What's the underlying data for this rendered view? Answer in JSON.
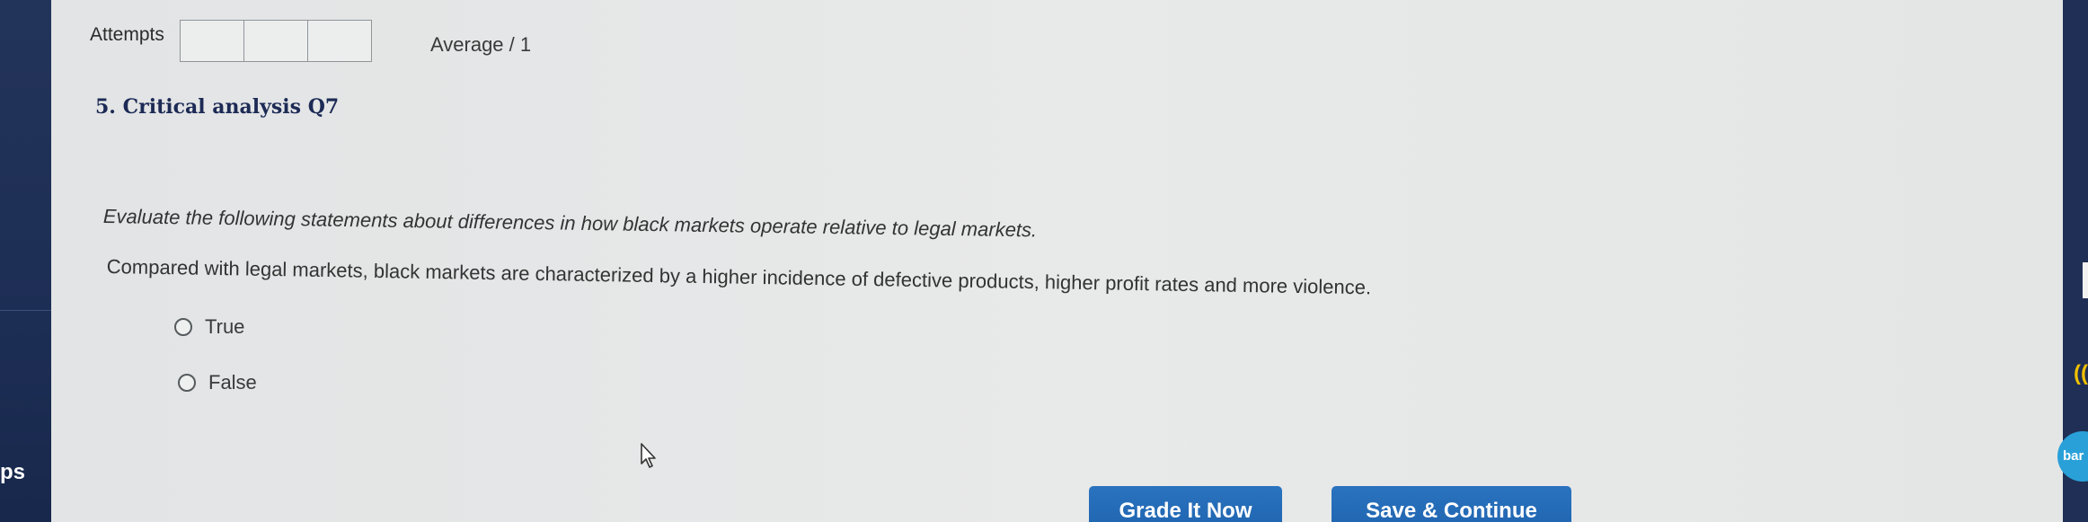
{
  "left_rail": {
    "label": "ps"
  },
  "right_rail": {
    "wifi_symbol": "((",
    "badge_text": "bar"
  },
  "attempts": {
    "label": "Attempts",
    "boxes": 3
  },
  "average": {
    "label": "Average / 1"
  },
  "question": {
    "title": "5. Critical analysis Q7",
    "prompt": "Evaluate the following statements about differences in how black markets operate relative to legal markets.",
    "statement": "Compared with legal markets, black markets are characterized by a higher incidence of defective products, higher profit rates and more violence.",
    "options": [
      {
        "label": "True",
        "selected": false
      },
      {
        "label": "False",
        "selected": false
      }
    ]
  },
  "buttons": {
    "grade": "Grade It Now",
    "save": "Save & Continue"
  },
  "colors": {
    "sidebar": "#1d2e55",
    "title": "#1c2a55",
    "button": "#2268b4",
    "badge": "#2aa0d8",
    "wifi": "#f0c000"
  },
  "icons": {
    "cursor": "mouse-pointer-icon",
    "wifi": "wifi-icon"
  }
}
